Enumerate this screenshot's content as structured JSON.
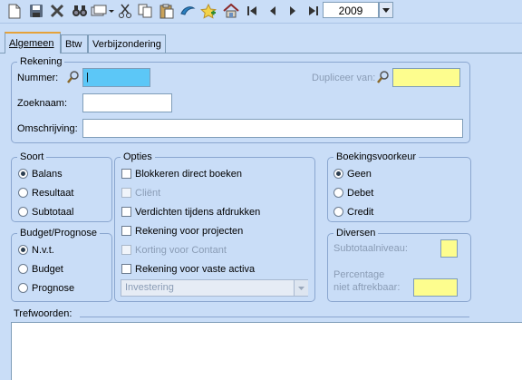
{
  "toolbar": {
    "icons": [
      "new-document-icon",
      "save-icon",
      "delete-icon",
      "search-binoculars-icon",
      "copy-dropdown-icon",
      "cut-icon",
      "copy-icon",
      "paste-icon",
      "print-icon",
      "favorite-icon",
      "home-icon",
      "first-record-icon",
      "previous-record-icon",
      "next-record-icon",
      "last-record-icon"
    ],
    "year": "2009"
  },
  "tabs": [
    "Algemeen",
    "Btw",
    "Verbijzondering"
  ],
  "rekening": {
    "legend": "Rekening",
    "nummer_label": "Nummer:",
    "nummer_value": "|",
    "dupliceer_label": "Dupliceer van:",
    "zoeknaam_label": "Zoeknaam:",
    "omschrijving_label": "Omschrijving:"
  },
  "soort": {
    "legend": "Soort",
    "options": [
      "Balans",
      "Resultaat",
      "Subtotaal"
    ],
    "selected": "Balans"
  },
  "budget": {
    "legend": "Budget/Prognose",
    "options": [
      "N.v.t.",
      "Budget",
      "Prognose"
    ],
    "selected": "N.v.t."
  },
  "opties": {
    "legend": "Opties",
    "items": [
      {
        "label": "Blokkeren direct boeken",
        "enabled": true
      },
      {
        "label": "Cliënt",
        "enabled": false
      },
      {
        "label": "Verdichten tijdens afdrukken",
        "enabled": true
      },
      {
        "label": "Rekening voor projecten",
        "enabled": true
      },
      {
        "label": "Korting voor Contant",
        "enabled": false
      },
      {
        "label": "Rekening voor vaste activa",
        "enabled": true
      }
    ],
    "activa_select": "Investering"
  },
  "boekingsvoorkeur": {
    "legend": "Boekingsvoorkeur",
    "options": [
      "Geen",
      "Debet",
      "Credit"
    ],
    "selected": "Geen"
  },
  "diversen": {
    "legend": "Diversen",
    "subtotaal_label": "Subtotaalniveau:",
    "percentage_label_1": "Percentage",
    "percentage_label_2": "niet aftrekbaar:"
  },
  "trefwoorden": {
    "label": "Trefwoorden:"
  },
  "colors": {
    "background": "#c9ddf7",
    "highlight_cyan": "#5cc7f7",
    "highlight_yellow": "#fdfd8e",
    "tab_accent": "#e5a23a"
  }
}
